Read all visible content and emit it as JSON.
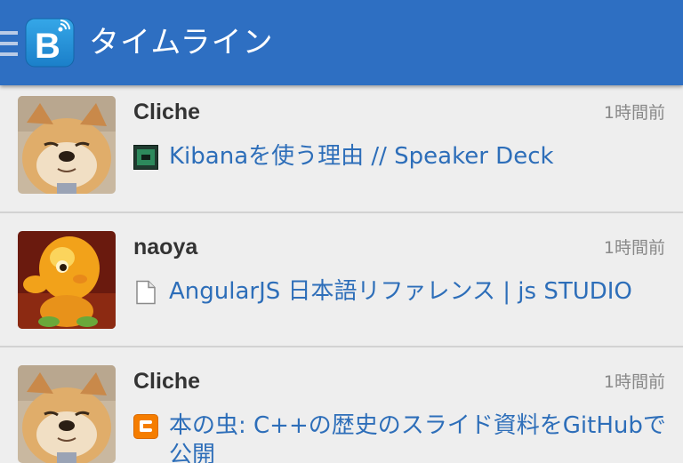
{
  "header": {
    "title": "タイムライン",
    "bar_color": "#2e6fc2",
    "logo_letter": "B"
  },
  "timeline": [
    {
      "user": "Cliche",
      "avatar": "shiba-dog-avatar",
      "time": "1時間前",
      "favicon": "speaker-deck-icon",
      "link_title": "Kibanaを使う理由 // Speaker Deck"
    },
    {
      "user": "naoya",
      "avatar": "orange-figure-avatar",
      "time": "1時間前",
      "favicon": "document-icon",
      "link_title": "AngularJS 日本語リファレンス | js STUDIO"
    },
    {
      "user": "Cliche",
      "avatar": "shiba-dog-avatar",
      "time": "1時間前",
      "favicon": "blogger-icon",
      "link_title": "本の虫: C++の歴史のスライド資料をGitHubで公開"
    }
  ],
  "colors": {
    "link": "#2d6eb9",
    "username": "#333333",
    "timestamp": "#888888",
    "background": "#eeeeee"
  }
}
